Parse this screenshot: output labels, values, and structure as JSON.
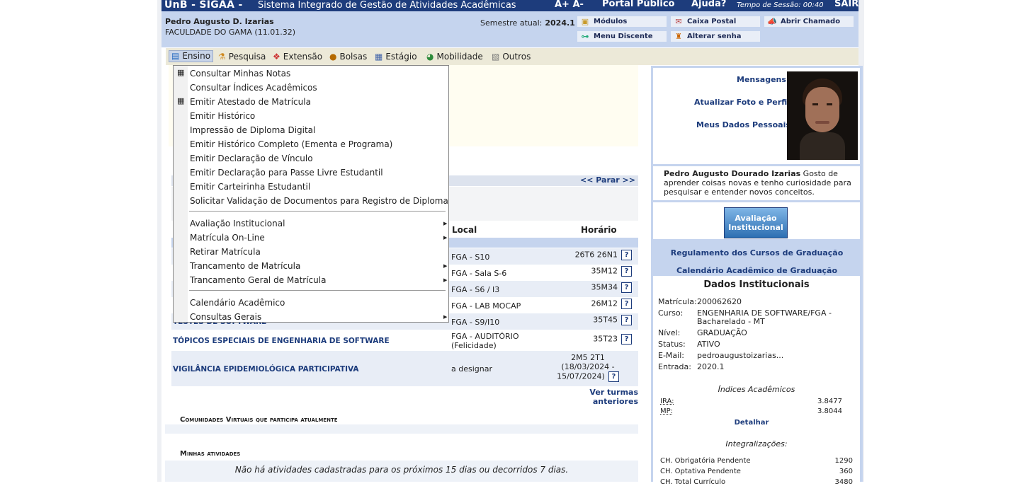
{
  "topbar": {
    "app": "UnB - SIGAA -",
    "system": "Sistema Integrado de Gestão de Atividades Acadêmicas",
    "font_controls": "A+ A-",
    "portal": "Portal Público",
    "help": "Ajuda?",
    "session_label": "Tempo de Sessão: 00:40",
    "logout": "SAIR"
  },
  "user": {
    "name": "Pedro Augusto D. Izarias",
    "faculty": "FACULDADE DO GAMA (11.01.32)",
    "semester_label": "Semestre atual:",
    "semester": "2024.1"
  },
  "quick": {
    "modulos": "Módulos",
    "caixa": "Caixa Postal",
    "chamado": "Abrir Chamado",
    "menu_discente": "Menu Discente",
    "senha": "Alterar senha"
  },
  "menu": {
    "ensino": "Ensino",
    "pesquisa": "Pesquisa",
    "extensao": "Extensão",
    "bolsas": "Bolsas",
    "estagio": "Estágio",
    "mobilidade": "Mobilidade",
    "outros": "Outros"
  },
  "dropdown": [
    "Consultar Minhas Notas",
    "Consultar Índices Acadêmicos",
    "Emitir Atestado de Matrícula",
    "Emitir Histórico",
    "Impressão de Diploma Digital",
    "Emitir Histórico Completo (Ementa e Programa)",
    "Emitir Declaração de Vínculo",
    "Emitir Declaração para Passe Livre Estudantil",
    "Emitir Carteirinha Estudantil",
    "Solicitar Validação de Documentos para Registro de Diploma",
    "Avaliação Institucional",
    "Matrícula On-Line",
    "Retirar Matrícula",
    "Trancamento de Matrícula",
    "Trancamento Geral de Matrícula",
    "Calendário Acadêmico",
    "Consultas Gerais"
  ],
  "turmas": {
    "parar": "<< Parar >>",
    "col_local": "Local",
    "col_horario": "Horário",
    "rows": [
      {
        "name": "",
        "local": "FGA - S10",
        "horario": "26T6 26N1"
      },
      {
        "name": "",
        "local": "FGA - Sala S-6",
        "horario": "35M12"
      },
      {
        "name": "",
        "local": "FGA - S6 / I3",
        "horario": "35M34"
      },
      {
        "name": "",
        "local": "FGA - LAB MOCAP",
        "horario": "26M12"
      },
      {
        "name": "TESTES DE SOFTWARE",
        "local": "FGA - S9/I10",
        "horario": "35T45"
      },
      {
        "name": "TÓPICOS ESPECIAIS DE ENGENHARIA DE SOFTWARE",
        "local": "FGA - AUDITÓRIO",
        "local2": "(Felicidade)",
        "horario": "35T23"
      },
      {
        "name": "VIGILÂNCIA EPIDEMIOLÓGICA PARTICIPATIVA",
        "local": "a designar",
        "horario": "2M5 2T1",
        "horario2": "(18/03/2024 -",
        "horario3": "15/07/2024)"
      }
    ],
    "anteriores": "Ver turmas anteriores"
  },
  "sections": {
    "comunidades": "Comunidades Virtuais que participa atualmente",
    "atividades": "Minhas atividades",
    "no_activities": "Não há atividades cadastradas para os próximos 15 dias ou decorridos 7 dias."
  },
  "profile": {
    "mensagens": "Mensagens",
    "foto": "Atualizar Foto e Perfil",
    "dados": "Meus Dados Pessoais",
    "full_name": "Pedro Augusto Dourado Izarias",
    "bio": "Gosto de aprender coisas novas e tenho curiosidade para pesquisar e entender novos conceitos.",
    "avaliacao_logo": "Avaliação Institucional",
    "regulamento": "Regulamento dos Cursos de Graduação",
    "calendario": "Calendário Acadêmico de Graduação"
  },
  "institucional": {
    "title": "Dados Institucionais",
    "matricula_l": "Matrícula:",
    "matricula": "200062620",
    "curso_l": "Curso:",
    "curso": "ENGENHARIA DE SOFTWARE/FGA -",
    "curso2": "Bacharelado - MT",
    "nivel_l": "Nível:",
    "nivel": "GRADUAÇÃO",
    "status_l": "Status:",
    "status": "ATIVO",
    "email_l": "E-Mail:",
    "email": "pedroaugustoizarias...",
    "entrada_l": "Entrada:",
    "entrada": "2020.1",
    "indices_title": "Índices Acadêmicos",
    "ira_l": "IRA:",
    "ira": "3.8477",
    "mp_l": "MP:",
    "mp": "3.8044",
    "detalhar": "Detalhar",
    "integ_title": "Integralizações:",
    "ch1_l": "CH. Obrigatória Pendente",
    "ch1": "1290",
    "ch2_l": "CH. Optativa Pendente",
    "ch2": "360",
    "ch3_l": "CH. Total Currículo",
    "ch3": "3480"
  }
}
